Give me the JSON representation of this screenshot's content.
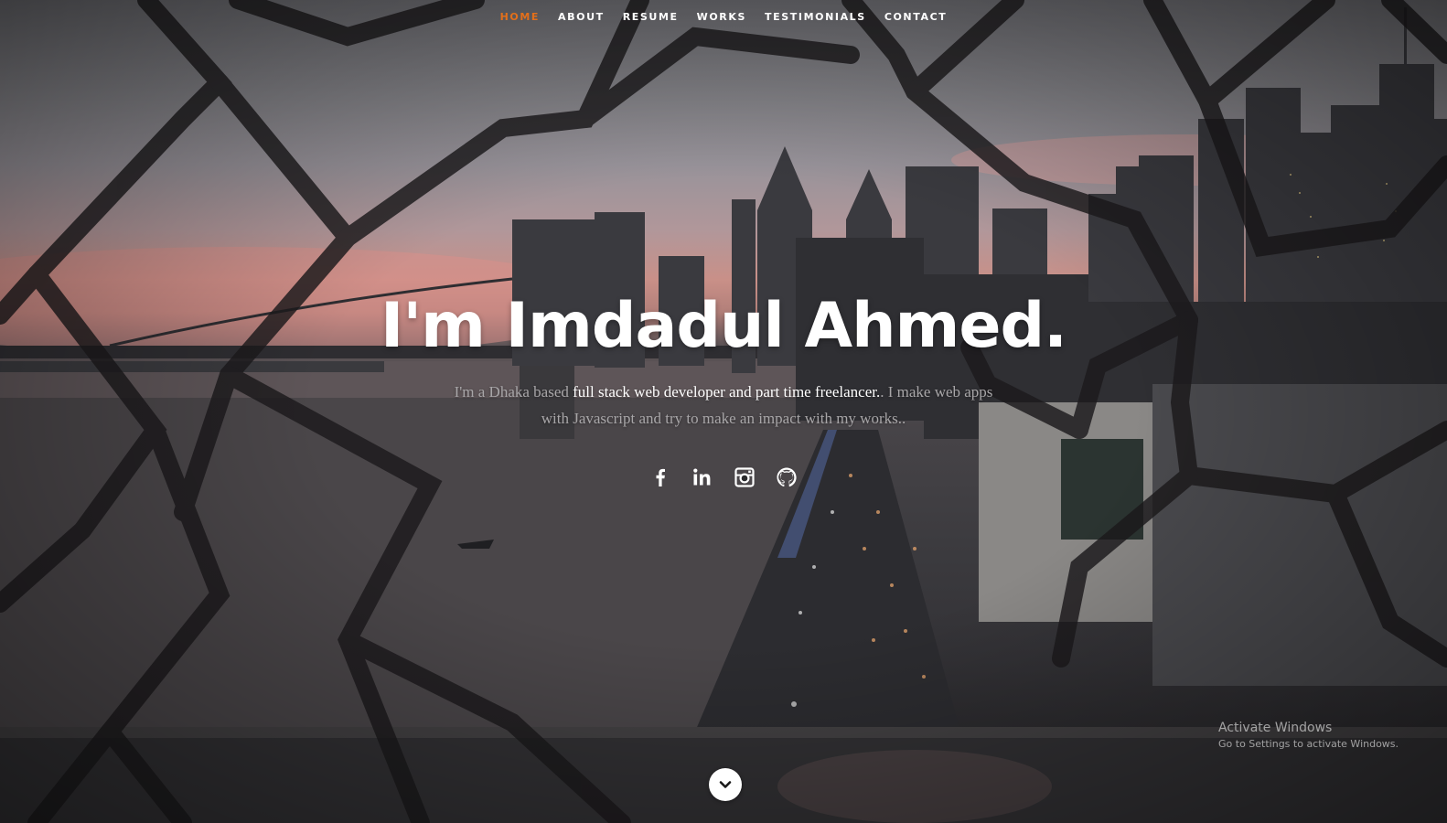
{
  "nav": {
    "items": [
      {
        "label": "Home",
        "current": true
      },
      {
        "label": "About",
        "current": false
      },
      {
        "label": "Resume",
        "current": false
      },
      {
        "label": "Works",
        "current": false
      },
      {
        "label": "Testimonials",
        "current": false
      },
      {
        "label": "Contact",
        "current": false
      }
    ]
  },
  "banner": {
    "headline": "I'm Imdadul Ahmed.",
    "intro_before": "I'm a Dhaka based ",
    "intro_highlight": "full stack web developer and part time freelancer.",
    "intro_after": ". I make web apps with Javascript and try to make an impact with my works.."
  },
  "social": [
    {
      "icon": "facebook-icon"
    },
    {
      "icon": "linkedin-icon"
    },
    {
      "icon": "instagram-icon"
    },
    {
      "icon": "github-icon"
    }
  ],
  "scrolldown": {
    "icon": "chevron-down-icon"
  },
  "watermark": {
    "title": "Activate Windows",
    "subtitle": "Go to Settings to activate Windows."
  },
  "colors": {
    "accent": "#e36f1a",
    "text": "#ffffff",
    "muted_text": "#a8a6a8"
  }
}
